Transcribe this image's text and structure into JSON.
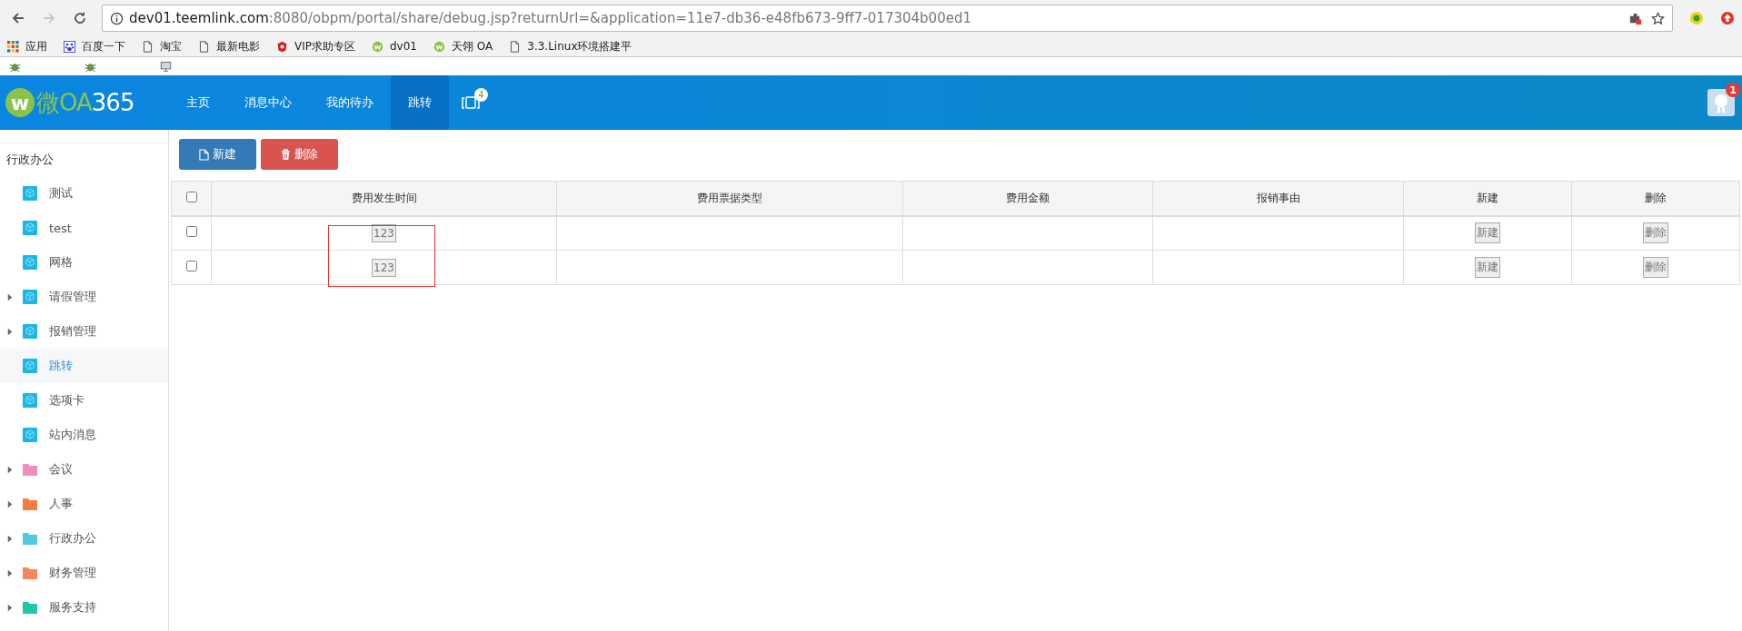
{
  "browser": {
    "url_host": "dev01.teemlink.com",
    "url_rest": ":8080/obpm/portal/share/debug.jsp?returnUrl=&application=11e7-db36-e48fb673-9ff7-017304b00ed1",
    "forward_disabled": true,
    "bookmarks": [
      {
        "kind": "apps",
        "label": "应用"
      },
      {
        "kind": "paw",
        "label": "百度一下"
      },
      {
        "kind": "page",
        "label": "淘宝"
      },
      {
        "kind": "page",
        "label": "最新电影"
      },
      {
        "kind": "vip",
        "label": "VIP求助专区"
      },
      {
        "kind": "w",
        "label": "dv01"
      },
      {
        "kind": "w",
        "label": "天翎 OA"
      },
      {
        "kind": "page",
        "label": "3.3.Linux环境搭建平"
      }
    ]
  },
  "header": {
    "logo": {
      "mark": "w",
      "name": "微OA",
      "suffix": "365"
    },
    "nav": [
      {
        "label": "主页",
        "selected": false
      },
      {
        "label": "消息中心",
        "selected": false
      },
      {
        "label": "我的待办",
        "selected": false
      },
      {
        "label": "跳转",
        "selected": true
      }
    ],
    "windows_badge": "4",
    "avatar_badge": "1"
  },
  "sidebar": {
    "heading": "行政办公",
    "items": [
      {
        "kind": "form",
        "label": "测试",
        "selected": false
      },
      {
        "kind": "form",
        "label": "test",
        "selected": false
      },
      {
        "kind": "form",
        "label": "网格",
        "selected": false
      },
      {
        "kind": "form",
        "label": "请假管理",
        "selected": false,
        "expanded": false
      },
      {
        "kind": "form",
        "label": "报销管理",
        "selected": false,
        "expanded": false
      },
      {
        "kind": "form",
        "label": "跳转",
        "selected": true
      },
      {
        "kind": "form",
        "label": "选项卡",
        "selected": false
      },
      {
        "kind": "form",
        "label": "站内消息",
        "selected": false
      },
      {
        "kind": "folder",
        "label": "会议",
        "selected": false,
        "expanded": false,
        "color": "#f08cc0"
      },
      {
        "kind": "folder",
        "label": "人事",
        "selected": false,
        "expanded": false,
        "color": "#f57c3c"
      },
      {
        "kind": "folder",
        "label": "行政办公",
        "selected": false,
        "expanded": false,
        "color": "#4ecbe0"
      },
      {
        "kind": "folder",
        "label": "财务管理",
        "selected": false,
        "expanded": false,
        "color": "#f5865e"
      },
      {
        "kind": "folder",
        "label": "服务支持",
        "selected": false,
        "expanded": false,
        "color": "#22c7a8"
      }
    ]
  },
  "toolbar": [
    {
      "kind": "new",
      "label": "新建"
    },
    {
      "kind": "delete",
      "label": "删除"
    }
  ],
  "table": {
    "all_checked": false,
    "columns": [
      "费用发生时间",
      "费用票据类型",
      "费用金额",
      "报销事由",
      "新建",
      "删除"
    ],
    "rows": [
      {
        "checked": false,
        "cells": [
          "123",
          "",
          "",
          "",
          "新建",
          "删除"
        ]
      },
      {
        "checked": false,
        "cells": [
          "123",
          "",
          "",
          "",
          "新建",
          "删除"
        ]
      }
    ]
  }
}
